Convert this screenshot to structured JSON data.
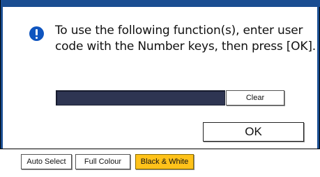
{
  "dialog": {
    "message_lines": [
      "To use the following function(s), enter user",
      "code with the Number keys, then press [OK]."
    ],
    "user_code_value": "",
    "clear_label": "Clear",
    "ok_label": "OK"
  },
  "color_modes": {
    "items": [
      {
        "label": "Auto Select",
        "selected": false
      },
      {
        "label": "Full Colour",
        "selected": false
      },
      {
        "label": "Black & White",
        "selected": true
      }
    ]
  },
  "colors": {
    "accent": "#1a4d91",
    "info_icon": "#0f55bf",
    "field_bg": "#2e3552",
    "selected_mode": "#ffc21a"
  },
  "icons": {
    "info": "exclamation-info-icon"
  }
}
